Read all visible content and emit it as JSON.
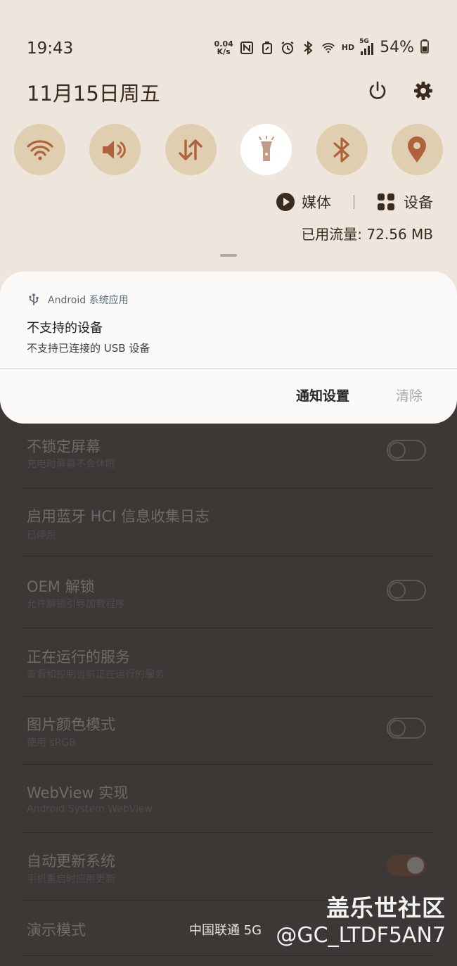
{
  "status_bar": {
    "time": "19:43",
    "net_speed_value": "0.04",
    "net_speed_unit": "K/s",
    "network_label": "HD",
    "network_type": "5G",
    "battery": "54%"
  },
  "header": {
    "date": "11月15日周五"
  },
  "quick_tiles": [
    {
      "icon": "wifi-icon",
      "active": false
    },
    {
      "icon": "sound-icon",
      "active": false
    },
    {
      "icon": "mobile-data-icon",
      "active": false
    },
    {
      "icon": "flashlight-icon",
      "active": true
    },
    {
      "icon": "bluetooth-icon",
      "active": false
    },
    {
      "icon": "location-icon",
      "active": false
    }
  ],
  "media": {
    "media_label": "媒体",
    "devices_label": "设备"
  },
  "data_usage": "已用流量: 72.56 MB",
  "notification": {
    "app_name": "Android 系统应用",
    "title": "不支持的设备",
    "text": "不支持已连接的 USB 设备",
    "settings_button": "通知设置",
    "clear_button": "清除"
  },
  "settings": [
    {
      "title": "不锁定屏幕",
      "subtitle": "充电时屏幕不会休眠",
      "toggle": "off"
    },
    {
      "title": "启用蓝牙 HCI 信息收集日志",
      "subtitle": "已停用",
      "toggle": null
    },
    {
      "title": "OEM 解锁",
      "subtitle": "允许解锁引导加载程序",
      "toggle": "off"
    },
    {
      "title": "正在运行的服务",
      "subtitle": "查看和控制当前正在运行的服务",
      "toggle": null
    },
    {
      "title": "图片颜色模式",
      "subtitle": "使用 sRGB",
      "toggle": "off"
    },
    {
      "title": "WebView 实现",
      "subtitle": "Android System WebView",
      "toggle": null
    },
    {
      "title": "自动更新系统",
      "subtitle": "手机重启时应用更新",
      "toggle": "on"
    },
    {
      "title": "演示模式",
      "subtitle": "",
      "toggle": null
    }
  ],
  "carrier": "中国联通 5G",
  "watermark": {
    "line1": "盖乐世社区",
    "line2": "@GC_LTDF5AN7"
  },
  "colors": {
    "shade": "#eee6dc",
    "tile": "#dfceb0",
    "icon": "#b0623c",
    "text": "#3a2a22"
  }
}
